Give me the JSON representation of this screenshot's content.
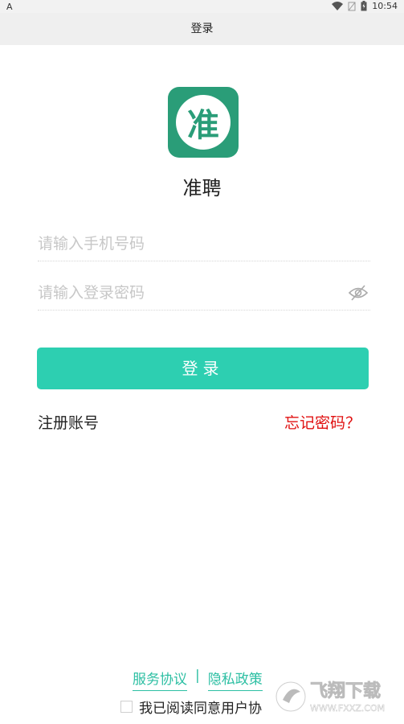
{
  "status_bar": {
    "left_icon": "android-notification-icon",
    "left_text": "A",
    "time": "10:54",
    "icons": [
      "wifi-icon",
      "no-sim-icon",
      "battery-charging-icon"
    ]
  },
  "app_bar": {
    "title": "登录"
  },
  "logo": {
    "glyph": "准",
    "icon": "app-logo-icon",
    "bg_color": "#2a9d78"
  },
  "app_name": "准聘",
  "form": {
    "phone": {
      "placeholder": "请输入手机号码",
      "value": ""
    },
    "password": {
      "placeholder": "请输入登录密码",
      "value": "",
      "toggle_icon": "eye-hidden-icon"
    },
    "login_label": "登录",
    "login_color": "#2dcfb1"
  },
  "links": {
    "register": "注册账号",
    "forgot": "忘记密码？",
    "forgot_color": "#e01010"
  },
  "footer": {
    "service": "服务协议",
    "separator": "|",
    "privacy": "隐私政策",
    "agree_text": "我已阅读同意用户协",
    "link_color": "#2dbfa3"
  },
  "watermark": {
    "text": "飞翔下载",
    "subtext": "WWW.FXXZ.COM",
    "icon": "watermark-logo-icon"
  }
}
